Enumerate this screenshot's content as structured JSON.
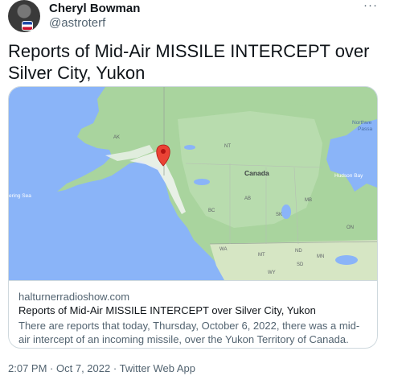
{
  "author": {
    "name": "Cheryl Bowman",
    "handle": "@astroterf"
  },
  "more_label": "···",
  "tweet_text": "Reports of Mid-Air MISSILE INTERCEPT over Silver City, Yukon",
  "card": {
    "domain": "halturnerradioshow.com",
    "title": "Reports of Mid-Air MISSILE INTERCEPT over Silver City, Yukon",
    "description": "There are reports that today, Thursday, October 6, 2022, there was a mid-air intercept of an incoming missile, over the Yukon Territory of Canada.",
    "map": {
      "labels": {
        "canada": "Canada",
        "northwest": "Northwe",
        "passage": "Passa",
        "hudson_bay": "Hudson Bay",
        "bering_sea": "ering Sea",
        "ak": "AK",
        "nt": "NT",
        "bc": "BC",
        "ab": "AB",
        "sk": "SK",
        "mb": "MB",
        "on": "ON",
        "nd": "ND",
        "mt": "MT",
        "sd": "SD",
        "mn": "MN",
        "wy": "WY",
        "wa": "WA"
      },
      "colors": {
        "water": "#8ab4f8",
        "land": "#a8d5a0",
        "snow": "#ffffff",
        "marker": "#ea4335"
      }
    }
  },
  "timestamp": {
    "time": "2:07 PM",
    "date": "Oct 7, 2022",
    "separator": "·",
    "source": "Twitter Web App"
  }
}
